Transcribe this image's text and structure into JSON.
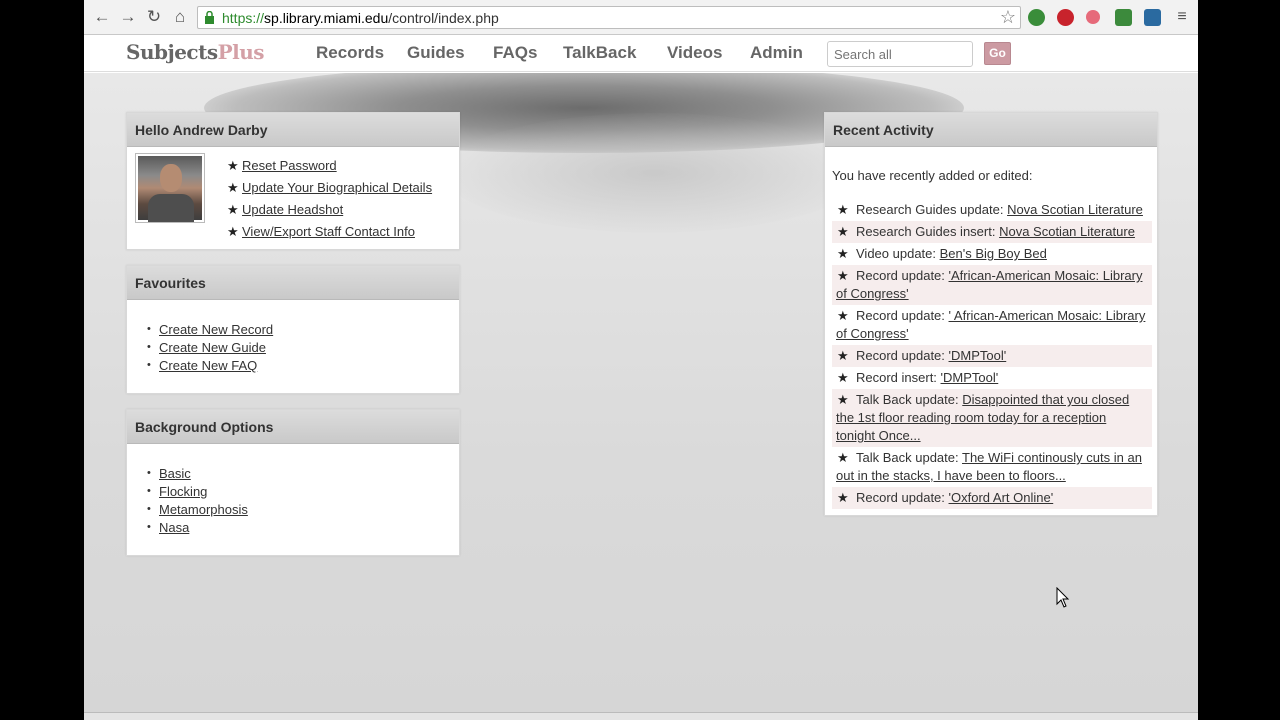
{
  "browser": {
    "url_scheme": "https://",
    "url_host": "sp.library.miami.edu",
    "url_path": "/control/index.php"
  },
  "app": {
    "logo_part1": "Subjects",
    "logo_part2": "Plus",
    "nav": [
      "Records",
      "Guides",
      "FAQs",
      "TalkBack",
      "Videos",
      "Admin"
    ],
    "search_placeholder": "Search all",
    "go_label": "Go"
  },
  "hello_panel": {
    "title": "Hello Andrew Darby",
    "links": [
      "Reset Password",
      "Update Your Biographical Details",
      "Update Headshot",
      "View/Export Staff Contact Info"
    ]
  },
  "favourites_panel": {
    "title": "Favourites",
    "links": [
      "Create New Record",
      "Create New Guide",
      "Create New FAQ"
    ]
  },
  "background_panel": {
    "title": "Background Options",
    "links": [
      "Basic",
      "Flocking",
      "Metamorphosis",
      "Nasa"
    ]
  },
  "recent_panel": {
    "title": "Recent Activity",
    "intro": "You have recently added or edited:",
    "items": [
      {
        "prefix": "Research Guides update:",
        "link": "Nova Scotian Literature"
      },
      {
        "prefix": "Research Guides insert:",
        "link": "Nova Scotian Literature"
      },
      {
        "prefix": "Video update:",
        "link": "Ben's Big Boy Bed"
      },
      {
        "prefix": "Record update:",
        "link": "'African-American Mosaic: Library of Congress'"
      },
      {
        "prefix": "Record update:",
        "link": "' African-American Mosaic: Library of Congress'"
      },
      {
        "prefix": "Record update:",
        "link": "'DMPTool'"
      },
      {
        "prefix": "Record insert:",
        "link": "'DMPTool'"
      },
      {
        "prefix": "Talk Back update:",
        "link": "Disappointed that you closed the 1st floor reading room today for a reception tonight Once..."
      },
      {
        "prefix": "Talk Back update:",
        "link": "The WiFi continously cuts in an out in the stacks, I have been to floors..."
      },
      {
        "prefix": "Record update:",
        "link": "'Oxford Art Online'"
      }
    ]
  },
  "colors": {
    "accent": "#cc9aa2",
    "logo_gray": "#666666",
    "logo_pink": "#d4a0a6"
  }
}
